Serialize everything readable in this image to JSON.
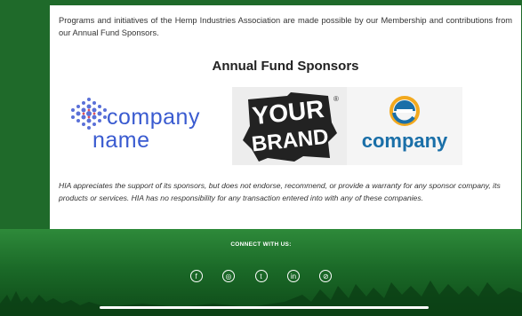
{
  "content": {
    "intro_text": "Programs and initiatives of the Hemp Industries Association are made possible by our Membership and contributions from our Annual Fund Sponsors.",
    "section_title": "Annual Fund Sponsors",
    "sponsors": [
      {
        "name_line1": "company",
        "name_line2": "name"
      },
      {
        "word1": "YOUR",
        "word2": "BRAND",
        "registered": "®"
      },
      {
        "word": "company"
      }
    ],
    "disclaimer": "HIA appreciates the support of its sponsors, but does not endorse, recommend, or provide a warranty for any sponsor company, its products or services. HIA has no responsibility for any transaction entered into with any of these companies."
  },
  "footer": {
    "connect_label": "CONNECT WITH US:",
    "social_icons": [
      "facebook-icon",
      "instagram-icon",
      "twitter-icon",
      "linkedin-icon",
      "link-icon"
    ],
    "social_glyphs": [
      "f",
      "◎",
      "t",
      "in",
      "⊘"
    ]
  },
  "colors": {
    "background_green": "#1f6a2a",
    "sponsor_blue": "#3a5bd0",
    "company_blue": "#1a6fa8"
  }
}
